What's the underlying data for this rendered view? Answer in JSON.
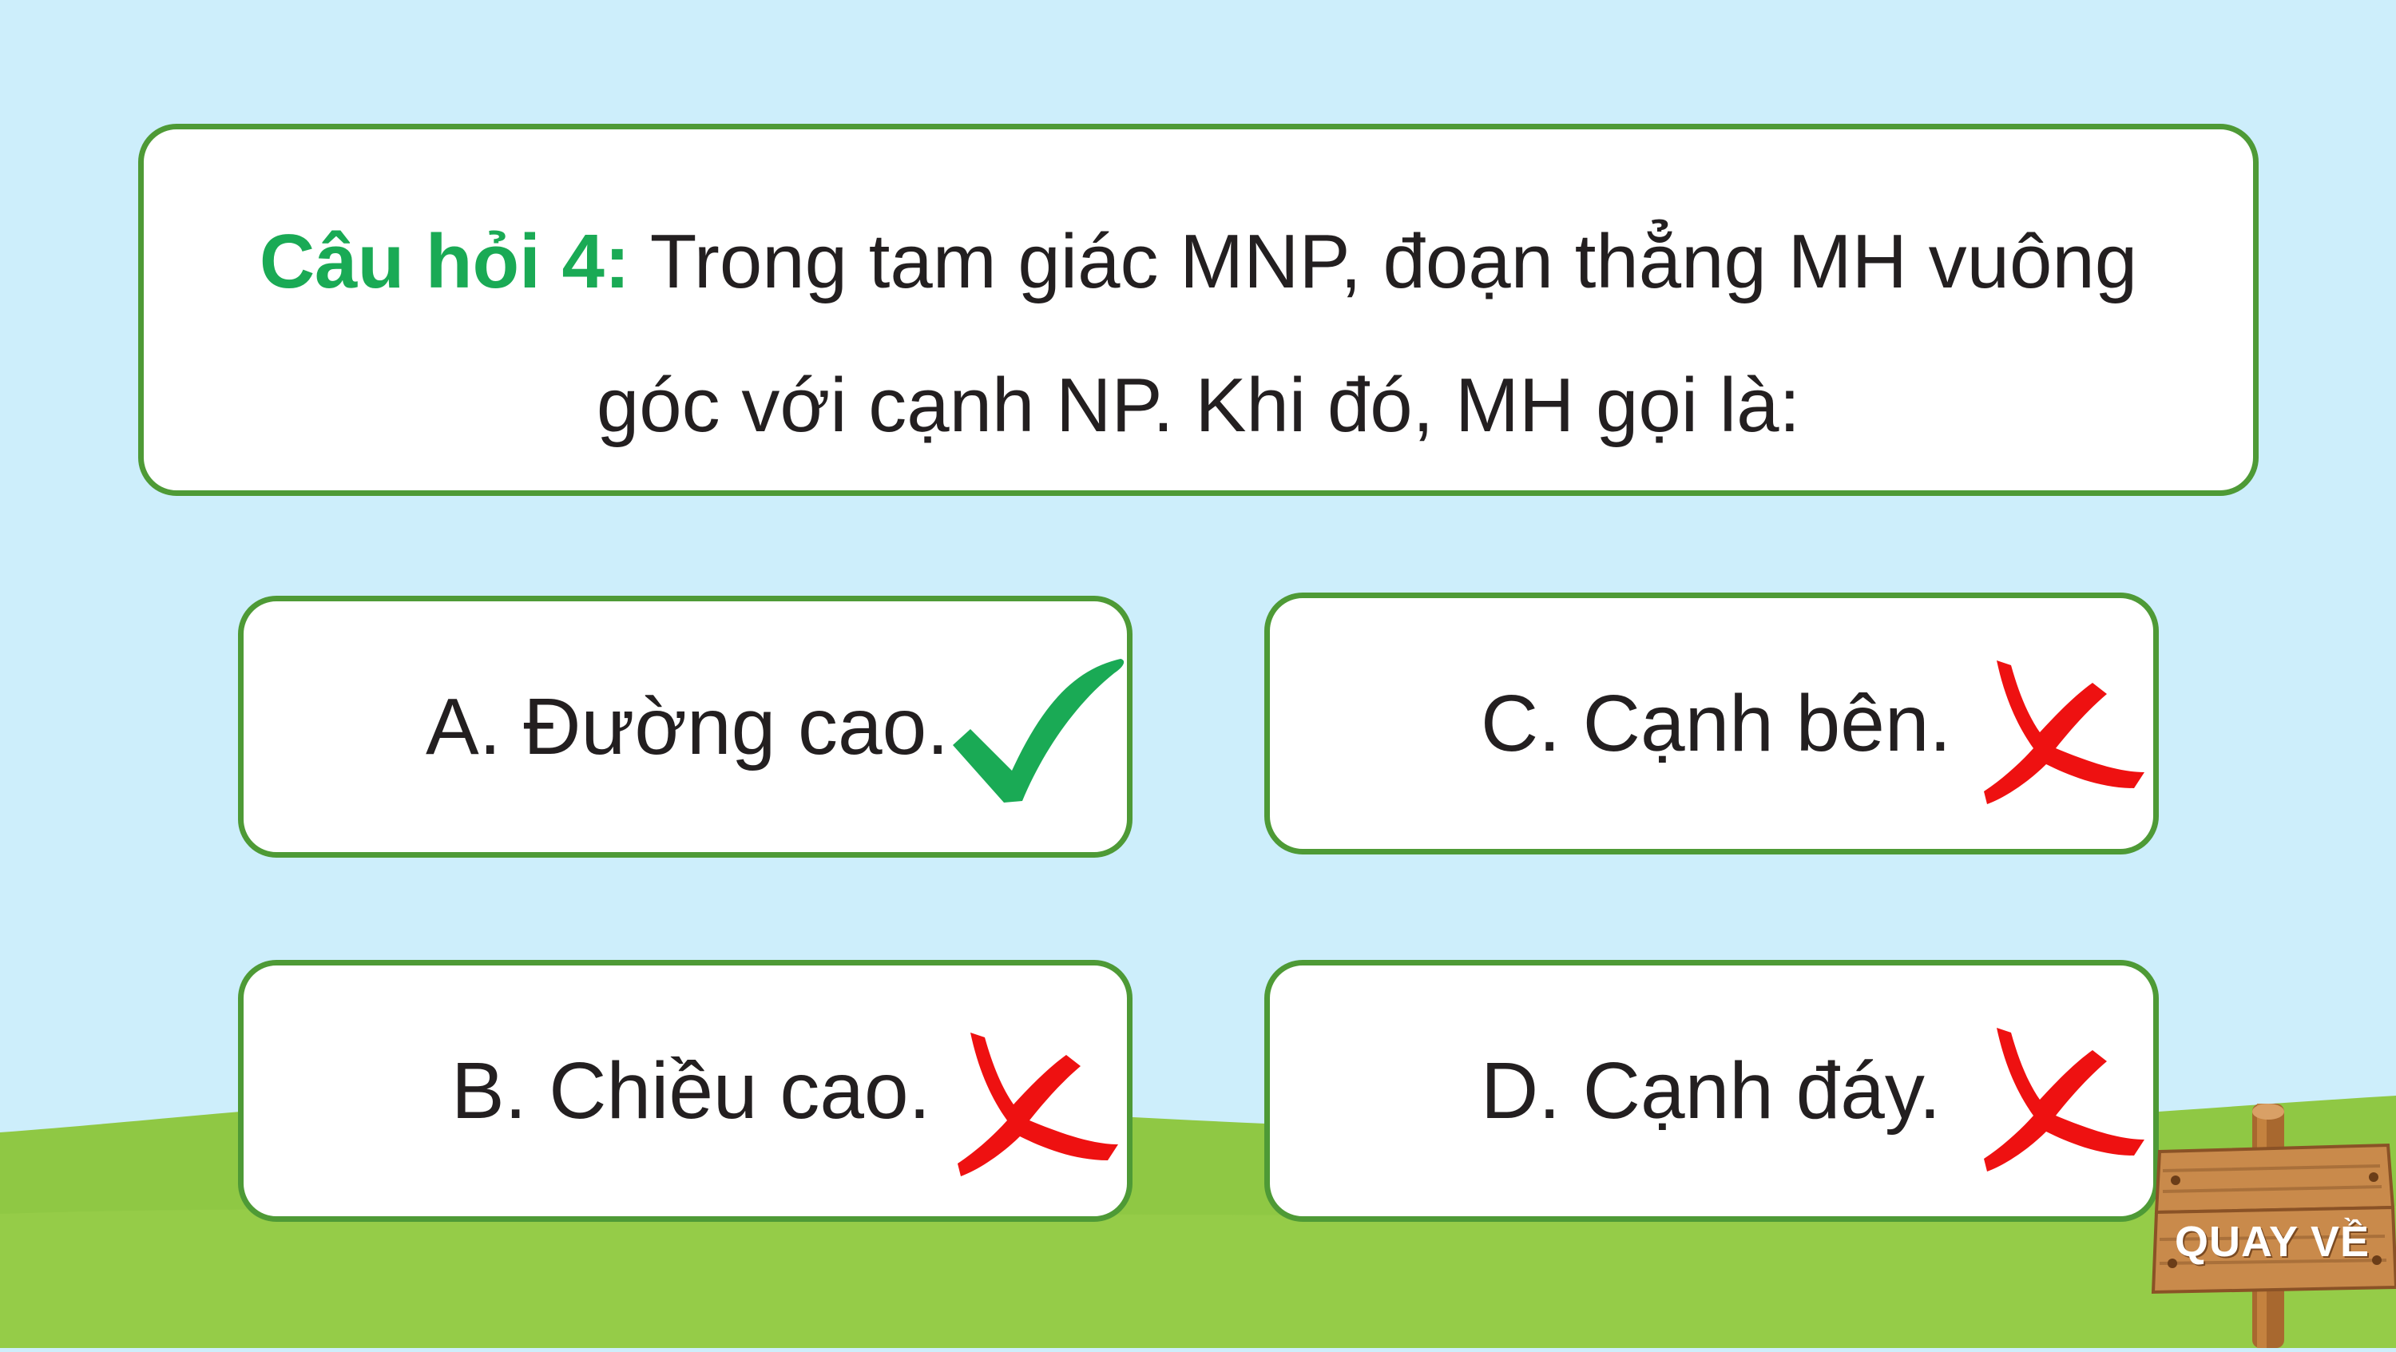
{
  "question": {
    "prefix": "Câu hỏi 4:",
    "line1": " Trong tam giác MNP, đoạn thẳng MH vuông",
    "line2": "góc với cạnh NP. Khi đó, MH gọi là:"
  },
  "answers": {
    "a": {
      "label": "A. Đường cao.",
      "status": "correct",
      "icon": "check-icon"
    },
    "b": {
      "label": "B. Chiều cao.",
      "status": "wrong",
      "icon": "cross-icon"
    },
    "c": {
      "label": "C. Cạnh bên.",
      "status": "wrong",
      "icon": "cross-icon"
    },
    "d": {
      "label": "D. Cạnh đáy.",
      "status": "wrong",
      "icon": "cross-icon"
    }
  },
  "back_button": {
    "label": "QUAY VỀ",
    "icon": "wooden-sign-icon"
  },
  "colors": {
    "sky": "#cdeefb",
    "grass": "#8fc844",
    "card_border": "#4e9a36",
    "question_prefix": "#1aaa55",
    "check": "#1aaa55",
    "cross": "#ee1111",
    "wood": "#c98a4b"
  }
}
